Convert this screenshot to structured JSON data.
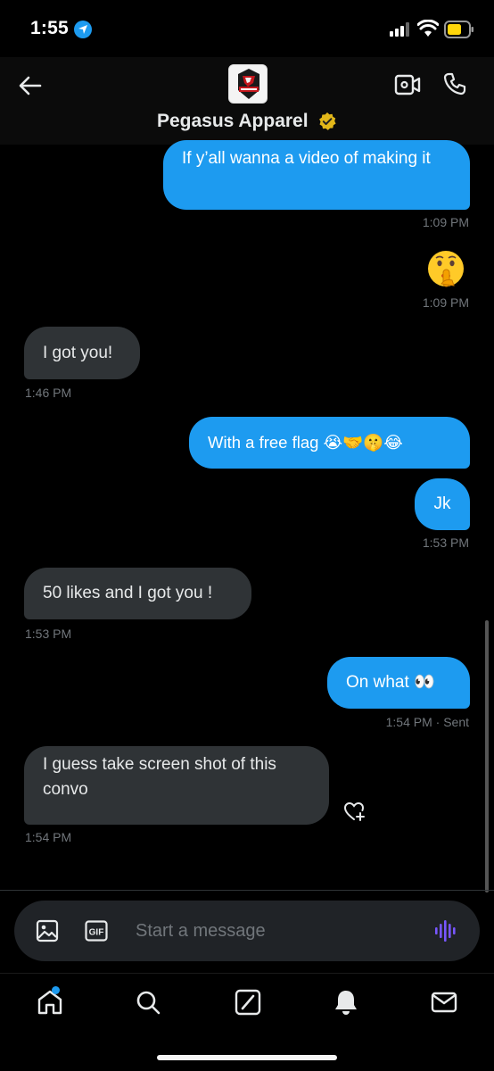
{
  "status_bar": {
    "time": "1:55"
  },
  "header": {
    "contact_name": "Pegasus Apparel"
  },
  "messages": [
    {
      "direction": "out",
      "text": "If y’all wanna a video of making it",
      "time": "1:09 PM"
    },
    {
      "direction": "out",
      "emoji": "shushing-face",
      "time": "1:09 PM"
    },
    {
      "direction": "in",
      "text": "I got you!",
      "time": "1:46 PM"
    },
    {
      "direction": "out",
      "text": "With a free flag 😭🤝🤫😂"
    },
    {
      "direction": "out",
      "text": "Jk",
      "time": "1:53 PM"
    },
    {
      "direction": "in",
      "text": "50 likes and I got you !",
      "time": "1:53 PM"
    },
    {
      "direction": "out",
      "text": "On what 👀",
      "time": "1:54 PM",
      "status": "· Sent"
    },
    {
      "direction": "in",
      "text": "I guess take screen shot of this convo",
      "time": "1:54 PM"
    }
  ],
  "composer": {
    "placeholder": "Start a message",
    "gif_label": "GIF"
  },
  "tabs": [
    "home",
    "search",
    "grok",
    "notifications",
    "messages"
  ],
  "colors": {
    "accent": "#1d9bf0",
    "incoming_bubble": "#2f3336",
    "background": "#000000",
    "voice": "#7856ff",
    "verified": "#e2b719"
  }
}
